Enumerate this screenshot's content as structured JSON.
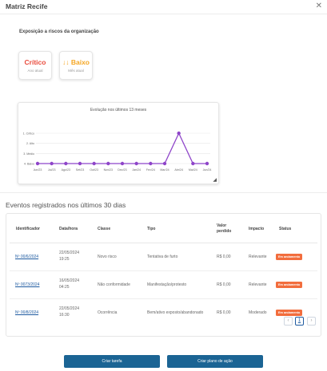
{
  "header": {
    "title": "Matriz Recife",
    "close_icon": "close-icon"
  },
  "risk": {
    "subtitle": "Exposição a riscos da organização",
    "cards": [
      {
        "value": "Crítico",
        "label": "Ano atual",
        "color": "#e94b3c"
      },
      {
        "value": "↓↓ Baixo",
        "label": "Mês atual",
        "color": "#f5a623"
      }
    ]
  },
  "chart_data": {
    "type": "line",
    "title": "Evolução nos últimos 13 meses",
    "categories": [
      "Jun/23",
      "Jul/23",
      "Ago/23",
      "Set/23",
      "Out/23",
      "Nov/23",
      "Dez/23",
      "Jan/24",
      "Fev/24",
      "Mar/24",
      "Abr/24",
      "Mai/24",
      "Jun/24"
    ],
    "y_ticks": [
      "1. Crítico",
      "2. Alto",
      "3. Médio",
      "4. Baixo"
    ],
    "ylim": [
      1,
      4
    ],
    "y_inverted": true,
    "values": [
      4,
      4,
      4,
      4,
      4,
      4,
      4,
      4,
      4,
      4,
      1,
      4,
      4
    ],
    "series_color": "#8e44c9",
    "grid": true
  },
  "events": {
    "title": "Eventos registrados nos últimos 30 dias",
    "headers": [
      "Identificador",
      "Data/hora",
      "Classe",
      "Tipo",
      "Valor perdido",
      "Impacto",
      "Status"
    ],
    "rows": [
      {
        "id": "Nº 00/6/2024",
        "date": "22/05/2024",
        "time": "19:25",
        "classe": "Novo risco",
        "tipo": "Tentativa de furto",
        "valor": "R$ 0,00",
        "impacto": "Relevante",
        "status": "Em andamento"
      },
      {
        "id": "Nº 0073/2024",
        "date": "16/05/2024",
        "time": "04:25",
        "classe": "Não conformidade",
        "tipo": "Manifestação/protesto",
        "valor": "R$ 0,00",
        "impacto": "Relevante",
        "status": "Em andamento"
      },
      {
        "id": "Nº 00/8/2024",
        "date": "22/05/2024",
        "time": "16:30",
        "classe": "Ocorrência",
        "tipo": "Bem/ativo exposto/abandonado",
        "valor": "R$ 0,00",
        "impacto": "Moderado",
        "status": "Em andamento"
      }
    ],
    "status_color": "#f26d3d",
    "pagination": {
      "prev": "‹",
      "current": "1",
      "next": "›"
    }
  },
  "actions": {
    "create_task": "Criar tarefa",
    "create_plan": "Criar plano de ação"
  }
}
